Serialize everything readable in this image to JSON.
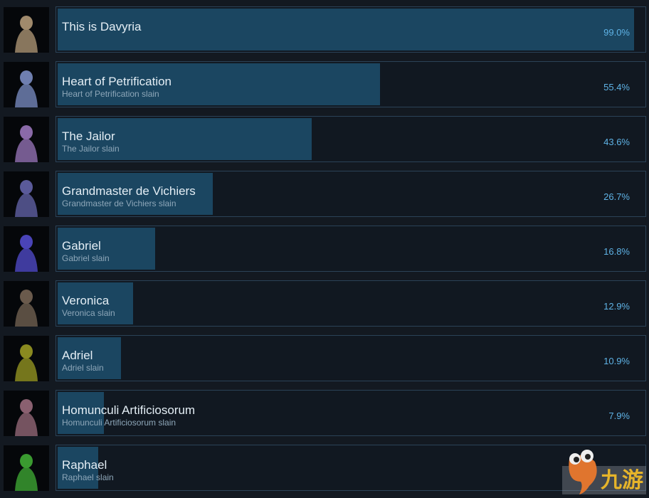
{
  "achievements": [
    {
      "name": "This is Davyria",
      "description": "",
      "percent": "99.0%",
      "value": 99.0,
      "icon": "angel-statue-icon",
      "tint": "#a08a6c"
    },
    {
      "name": "Heart of Petrification",
      "description": "Heart of Petrification slain",
      "percent": "55.4%",
      "value": 55.4,
      "icon": "stone-warrior-icon",
      "tint": "#6f7fb0"
    },
    {
      "name": "The Jailor",
      "description": "The Jailor slain",
      "percent": "43.6%",
      "value": 43.6,
      "icon": "jailor-monster-icon",
      "tint": "#8a6aa8"
    },
    {
      "name": "Grandmaster de Vichiers",
      "description": "Grandmaster de Vichiers slain",
      "percent": "26.7%",
      "value": 26.7,
      "icon": "armored-knight-icon",
      "tint": "#5a5a9a"
    },
    {
      "name": "Gabriel",
      "description": "Gabriel slain",
      "percent": "16.8%",
      "value": 16.8,
      "icon": "gabriel-warrior-icon",
      "tint": "#4a44b8"
    },
    {
      "name": "Veronica",
      "description": "Veronica slain",
      "percent": "12.9%",
      "value": 12.9,
      "icon": "spider-creature-icon",
      "tint": "#6a5a4c"
    },
    {
      "name": "Adriel",
      "description": "Adriel slain",
      "percent": "10.9%",
      "value": 10.9,
      "icon": "adriel-figure-icon",
      "tint": "#8a8a20"
    },
    {
      "name": "Homunculi Artificiosorum",
      "description": "Homunculi Artificiosorum slain",
      "percent": "7.9%",
      "value": 7.9,
      "icon": "homunculus-icon",
      "tint": "#8a6070"
    },
    {
      "name": "Raphael",
      "description": "Raphael slain",
      "percent": "",
      "value": 7.0,
      "icon": "raphael-figure-icon",
      "tint": "#3a9a30"
    }
  ],
  "watermark": {
    "text": "九游",
    "icon": "jiuyou-logo-icon"
  },
  "colors": {
    "bar": "#1b4661",
    "percent": "#5fb3e6",
    "background": "#131921"
  }
}
